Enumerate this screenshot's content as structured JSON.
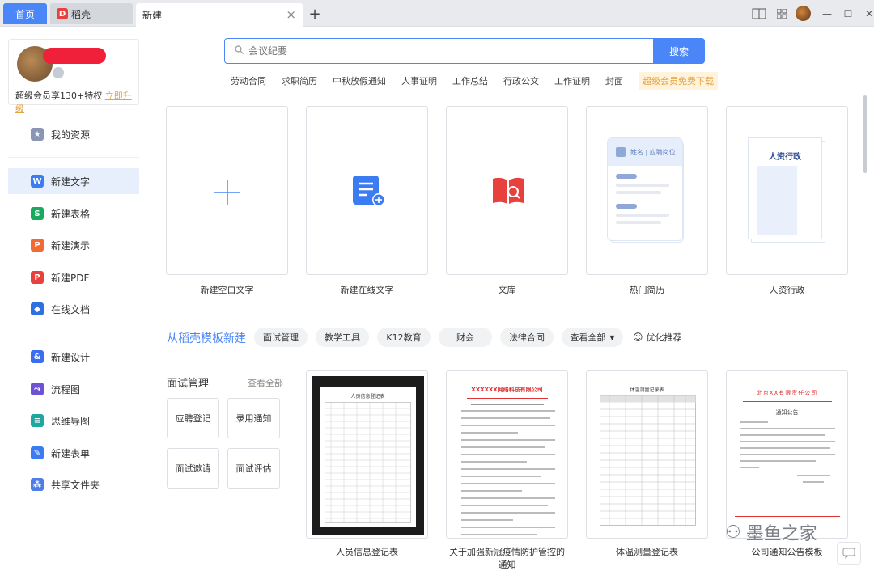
{
  "tabs": [
    {
      "label": "首页"
    },
    {
      "label": "稻壳"
    },
    {
      "label": "新建"
    }
  ],
  "sidebar": {
    "vip_text": "超级会员享130+特权",
    "upgrade": "立即升级",
    "items": [
      {
        "label": "我的资源",
        "icon": "star-icon",
        "color": "#8a96b3"
      },
      {
        "label": "新建文字",
        "icon": "w-icon",
        "color": "#3c7cf3"
      },
      {
        "label": "新建表格",
        "icon": "s-icon",
        "color": "#1aa95e"
      },
      {
        "label": "新建演示",
        "icon": "p-icon",
        "color": "#f06a35"
      },
      {
        "label": "新建PDF",
        "icon": "pdf-icon",
        "color": "#e8413d"
      },
      {
        "label": "在线文档",
        "icon": "cube-icon",
        "color": "#2f6fe0"
      },
      {
        "label": "新建设计",
        "icon": "design-icon",
        "color": "#3c6cf0"
      },
      {
        "label": "流程图",
        "icon": "flowchart-icon",
        "color": "#6d52d8"
      },
      {
        "label": "思维导图",
        "icon": "mindmap-icon",
        "color": "#1ea7a0"
      },
      {
        "label": "新建表单",
        "icon": "form-icon",
        "color": "#3c7cf3"
      },
      {
        "label": "共享文件夹",
        "icon": "share-folder-icon",
        "color": "#4f7de8"
      }
    ]
  },
  "search": {
    "placeholder": "会议纪要",
    "button": "搜索"
  },
  "hot_tags": [
    "劳动合同",
    "求职简历",
    "中秋放假通知",
    "人事证明",
    "工作总结",
    "行政公文",
    "工作证明",
    "封面"
  ],
  "vip_tag": "超级会员免费下载",
  "cards": [
    {
      "label": "新建空白文字"
    },
    {
      "label": "新建在线文字"
    },
    {
      "label": "文库"
    },
    {
      "label": "热门简历",
      "preview_text": "姓名 | 应聘岗位"
    },
    {
      "label": "人资行政",
      "preview_text": "人资行政"
    }
  ],
  "templates": {
    "title": "从稻壳模板新建",
    "chips": [
      "面试管理",
      "教学工具",
      "K12教育",
      "财会",
      "法律合同",
      "查看全部"
    ],
    "optimize": "优化推荐"
  },
  "interview": {
    "title": "面试管理",
    "see_all": "查看全部",
    "buttons": [
      "应聘登记",
      "录用通知",
      "面试邀请",
      "面试评估"
    ]
  },
  "docs": [
    {
      "label": "人员信息登记表",
      "heading": "人员信息登记表"
    },
    {
      "label": "关于加强新冠疫情防护管控的通知",
      "heading": "XXXXXX网络科技有限公司"
    },
    {
      "label": "体温测量登记表",
      "heading": "体温测量记录表"
    },
    {
      "label": "公司通知公告模板",
      "heading": "北京XX有限责任公司",
      "subheading": "通知公告"
    }
  ],
  "watermark": "墨鱼之家"
}
